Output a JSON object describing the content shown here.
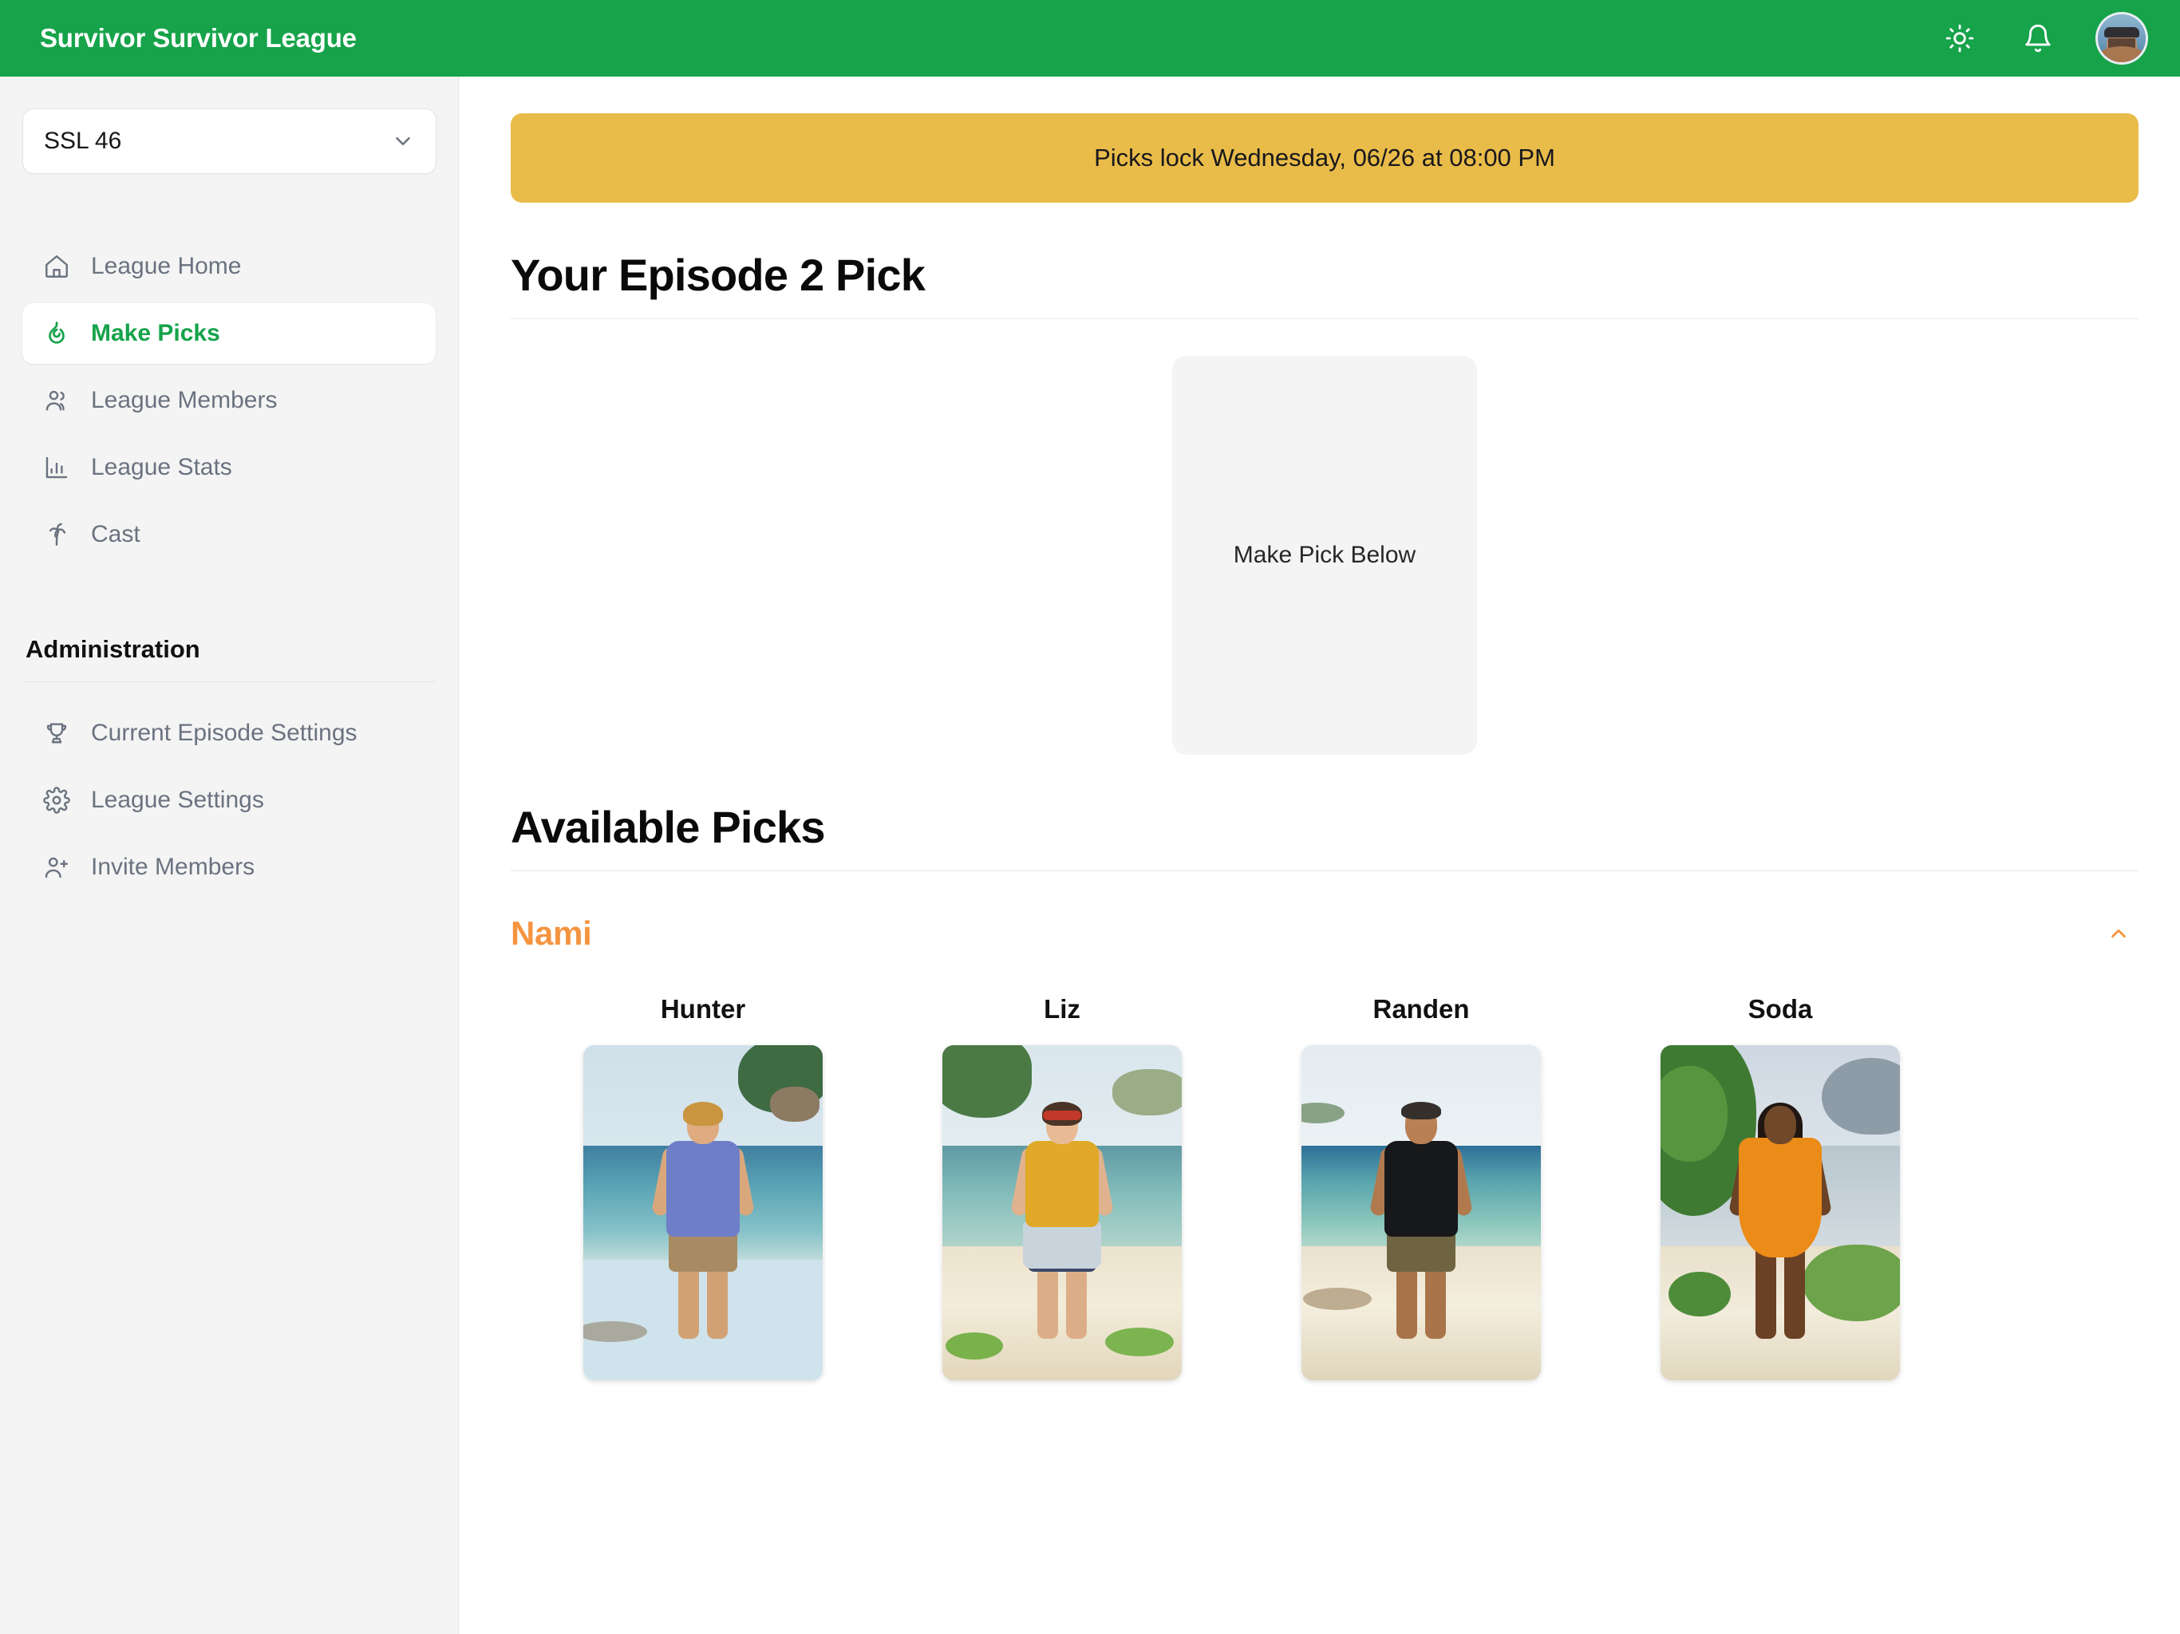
{
  "header": {
    "app_title": "Survivor Survivor League",
    "brand_color": "#16a34a",
    "theme_toggle_icon": "sun-icon",
    "notifications_icon": "bell-icon",
    "avatar_icon": "user-avatar"
  },
  "sidebar": {
    "league_selector": {
      "value": "SSL 46",
      "chevron_icon": "chevron-down-icon"
    },
    "nav": [
      {
        "label": "League Home",
        "icon": "home-icon",
        "active": false
      },
      {
        "label": "Make Picks",
        "icon": "flame-icon",
        "active": true
      },
      {
        "label": "League Members",
        "icon": "users-icon",
        "active": false
      },
      {
        "label": "League Stats",
        "icon": "bar-chart-icon",
        "active": false
      },
      {
        "label": "Cast",
        "icon": "palm-tree-icon",
        "active": false
      }
    ],
    "admin_title": "Administration",
    "admin_nav": [
      {
        "label": "Current Episode Settings",
        "icon": "trophy-icon"
      },
      {
        "label": "League Settings",
        "icon": "gear-icon"
      },
      {
        "label": "Invite Members",
        "icon": "user-plus-icon"
      }
    ]
  },
  "main": {
    "lock_banner": {
      "text": "Picks lock Wednesday, 06/26 at 08:00 PM",
      "color": "#e9bc4a"
    },
    "pick_heading": "Your Episode 2 Pick",
    "pick_slot_label": "Make Pick Below",
    "available_heading": "Available Picks",
    "tribes": [
      {
        "name": "Nami",
        "color": "#f59440",
        "toggle_icon": "chevron-up-icon",
        "expanded": true,
        "members": [
          {
            "name": "Hunter",
            "photo_alt": "man in blue patterned shirt on beach"
          },
          {
            "name": "Liz",
            "photo_alt": "woman with red headband and yellow top on beach"
          },
          {
            "name": "Randen",
            "photo_alt": "man in black shirt and olive shorts on beach"
          },
          {
            "name": "Soda",
            "photo_alt": "woman in orange dress with braids near foliage"
          }
        ]
      }
    ]
  }
}
